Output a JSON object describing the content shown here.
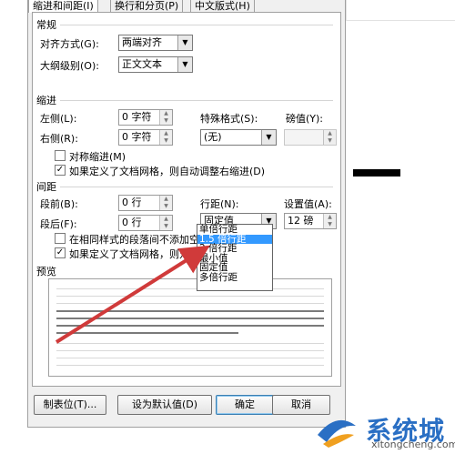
{
  "tabs": [
    "缩进和间距(I)",
    "换行和分页(P)",
    "中文版式(H)"
  ],
  "general": {
    "section": "常规",
    "alignment_label": "对齐方式(G):",
    "alignment_value": "两端对齐",
    "outline_label": "大纲级别(O):",
    "outline_value": "正文文本"
  },
  "indent": {
    "section": "缩进",
    "left_label": "左侧(L):",
    "left_value": "0 字符",
    "right_label": "右侧(R):",
    "right_value": "0 字符",
    "special_label": "特殊格式(S):",
    "special_value": "(无)",
    "by_label": "磅值(Y):",
    "by_value": "",
    "mirror_label": "对称缩进(M)",
    "mirror_checked": false,
    "auto_right_label": "如果定义了文档网格，则自动调整右缩进(D)",
    "auto_right_checked": true
  },
  "spacing": {
    "section": "间距",
    "before_label": "段前(B):",
    "before_value": "0 行",
    "after_label": "段后(F):",
    "after_value": "0 行",
    "line_label": "行距(N):",
    "line_value": "固定值",
    "at_label": "设置值(A):",
    "at_value": "12 磅",
    "no_space_label": "在相同样式的段落间不添加空格",
    "no_space_checked": false,
    "snap_label": "如果定义了文档网格，则对齐到",
    "snap_checked": true
  },
  "line_dropdown": {
    "options": [
      "单倍行距",
      "1.5 倍行距",
      "2 倍行距",
      "最小值",
      "固定值",
      "多倍行距"
    ],
    "selected_index": 1
  },
  "preview": {
    "label": "预览"
  },
  "buttons": {
    "tabs": "制表位(T)...",
    "default": "设为默认值(D)",
    "ok": "确定",
    "cancel": "取消"
  },
  "watermark": {
    "title": "系统城",
    "url": "xitongcheng.com"
  },
  "colors": {
    "arrow": "#d03a3a",
    "selection": "#3399ff",
    "watermark": "#2a6fc4"
  },
  "icons": [
    "chevron-down-icon",
    "spin-up-icon",
    "spin-down-icon",
    "checkmark-icon",
    "arrow-annotation-icon",
    "logo-icon"
  ]
}
